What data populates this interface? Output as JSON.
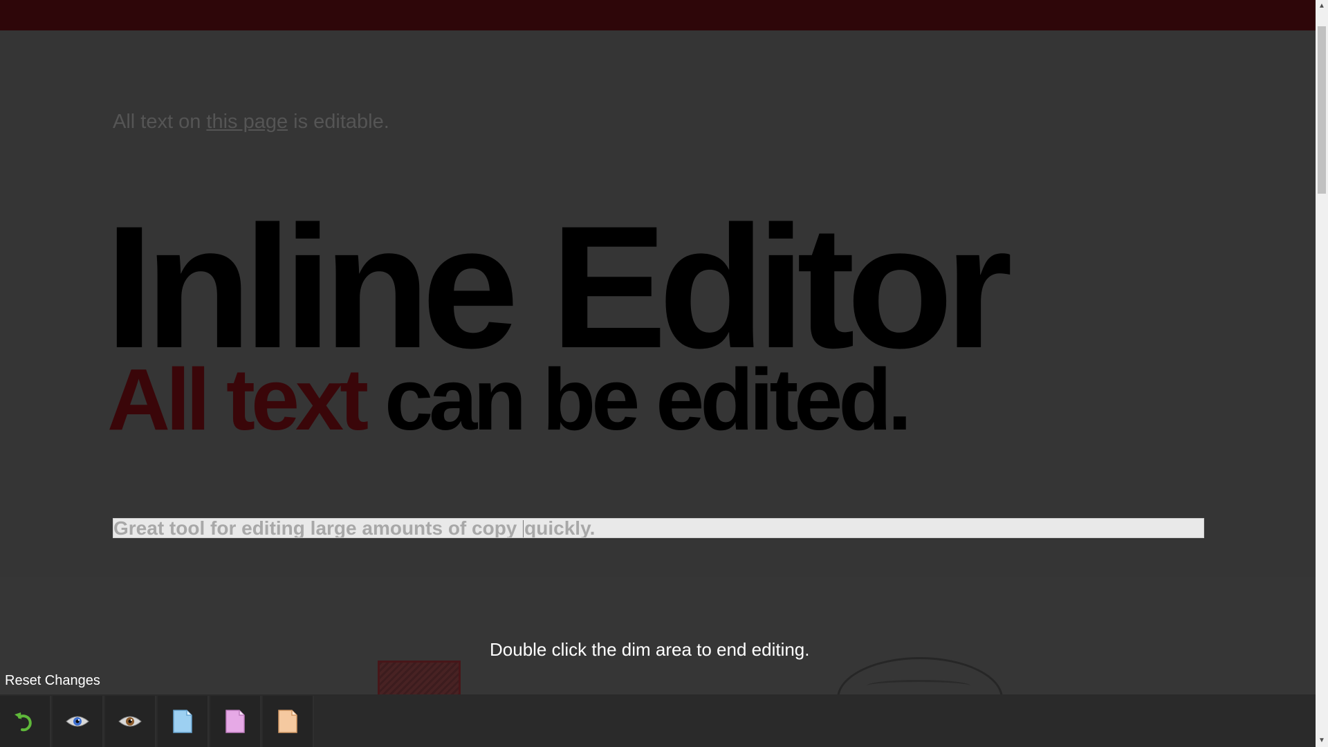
{
  "intro": {
    "prefix": "All text on ",
    "link": "this page",
    "suffix": " is editable."
  },
  "hero": {
    "title": "Inline Editor",
    "subtitle_accent": "All text",
    "subtitle_rest": " can be edited."
  },
  "editor": {
    "text_before_caret": "Great tool for editing large amounts of copy ",
    "text_after_caret": "quickly."
  },
  "hint": "Double click the dim area to end editing.",
  "toolbar": {
    "reset_label": "Reset Changes",
    "buttons": [
      {
        "icon": "undo-icon"
      },
      {
        "icon": "eye-blue-icon"
      },
      {
        "icon": "eye-brown-icon"
      },
      {
        "icon": "document-blue-icon"
      },
      {
        "icon": "document-pink-icon"
      },
      {
        "icon": "document-orange-icon"
      }
    ]
  },
  "colors": {
    "topbar": "#2e0609",
    "accent": "#3a0609",
    "background": "#353535",
    "undo": "#5fb83a"
  }
}
